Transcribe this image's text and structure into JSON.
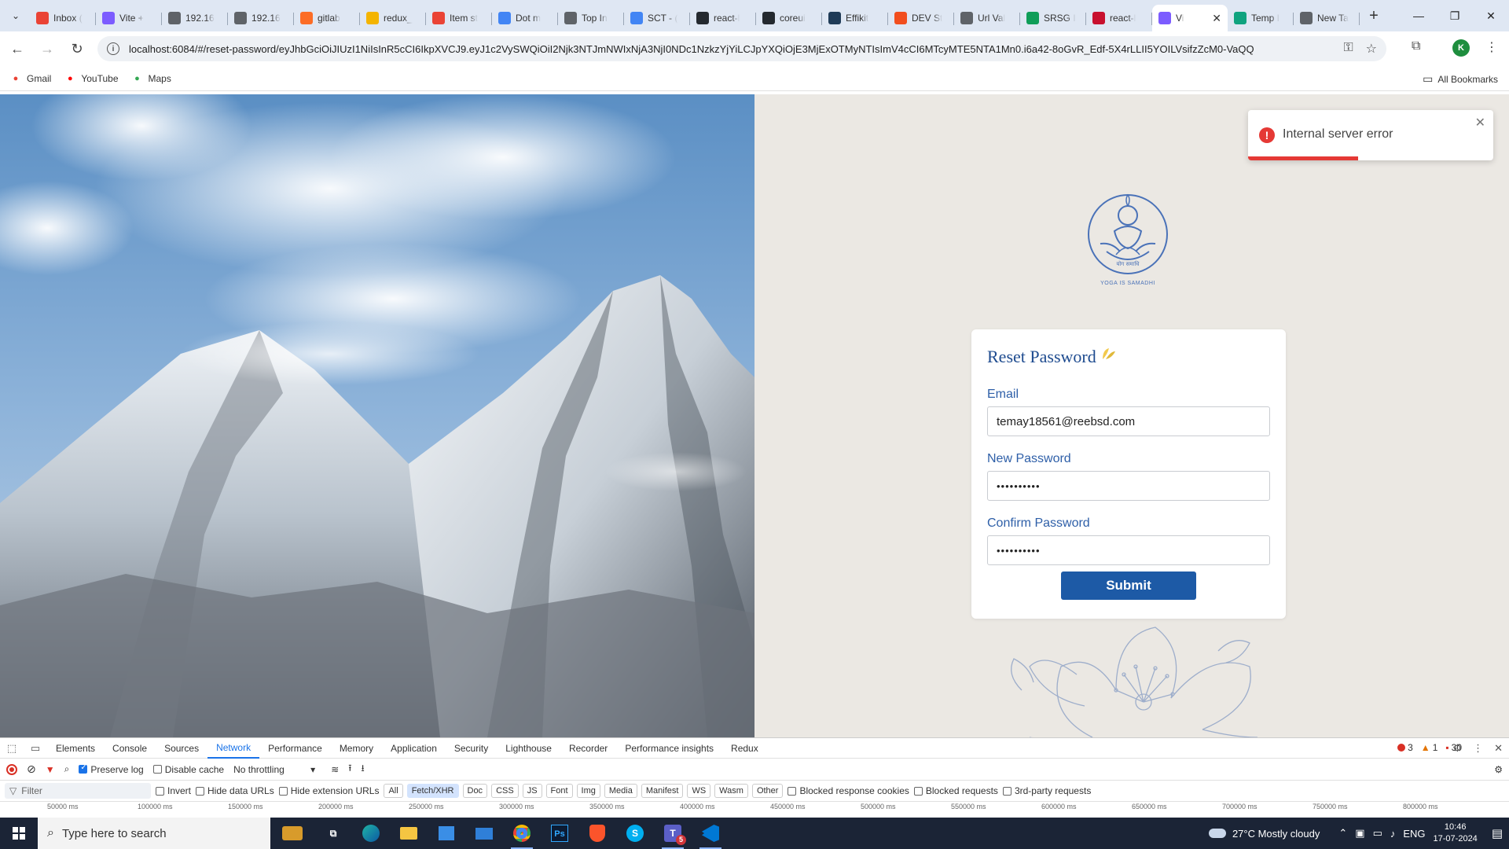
{
  "browser": {
    "tabs": [
      {
        "label": "Inbox (",
        "icon": "gmail-icon",
        "color": "#ea4335"
      },
      {
        "label": "Vite +",
        "icon": "vite-icon",
        "color": "#7c5cff"
      },
      {
        "label": "192.16",
        "icon": "globe-icon",
        "color": "#5f6368"
      },
      {
        "label": "192.16",
        "icon": "globe-icon",
        "color": "#5f6368"
      },
      {
        "label": "gitlab",
        "icon": "gitlab-icon",
        "color": "#fc6d26"
      },
      {
        "label": "redux_",
        "icon": "drive-icon",
        "color": "#f4b400"
      },
      {
        "label": "Item st",
        "icon": "gmail-icon",
        "color": "#ea4335"
      },
      {
        "label": "Dot m",
        "icon": "docs-icon",
        "color": "#4285f4"
      },
      {
        "label": "Top In",
        "icon": "leaf-icon",
        "color": "#5f6368"
      },
      {
        "label": "SCT - (",
        "icon": "docs-icon",
        "color": "#4285f4"
      },
      {
        "label": "react-l",
        "icon": "github-icon",
        "color": "#24292f"
      },
      {
        "label": "coreui",
        "icon": "github-icon",
        "color": "#24292f"
      },
      {
        "label": "Effikit",
        "icon": "effikit-icon",
        "color": "#1f3b57"
      },
      {
        "label": "DEV St",
        "icon": "figma-icon",
        "color": "#f24e1e"
      },
      {
        "label": "Url Val",
        "icon": "globe-icon",
        "color": "#5f6368"
      },
      {
        "label": "SRSG I",
        "icon": "sheets-icon",
        "color": "#0f9d58"
      },
      {
        "label": "react-l",
        "icon": "bookmark-icon",
        "color": "#c8102e"
      },
      {
        "label": "Vi",
        "icon": "vite-icon",
        "color": "#7c5cff",
        "active": true
      },
      {
        "label": "Temp I",
        "icon": "temp-icon",
        "color": "#10a37f"
      },
      {
        "label": "New Ta",
        "icon": "globe-icon",
        "color": "#5f6368"
      }
    ],
    "url": "localhost:6084/#/reset-password/eyJhbGciOiJIUzI1NiIsInR5cCI6IkpXVCJ9.eyJ1c2VySWQiOiI2Njk3NTJmNWIxNjA3NjI0NDc1NzkzYjYiLCJpYXQiOjE3MjExOTMyNTIsImV4cCI6MTcyMTE5NTA1Mn0.i6a42-8oGvR_Edf-5X4rLLII5YOILVsifzZcM0-VaQQ",
    "profile_initial": "K",
    "bookmarks": [
      {
        "label": "Gmail",
        "icon": "gmail-icon",
        "color": "#ea4335"
      },
      {
        "label": "YouTube",
        "icon": "youtube-icon",
        "color": "#ff0000"
      },
      {
        "label": "Maps",
        "icon": "maps-icon",
        "color": "#34a853"
      }
    ],
    "all_bookmarks_label": "All Bookmarks"
  },
  "page": {
    "logo_caption": "YOGA IS SAMADHI",
    "logo_script": "योग समाधि",
    "form": {
      "title": "Reset Password",
      "email_label": "Email",
      "email_value": "temay18561@reebsd.com",
      "new_password_label": "New Password",
      "new_password_value": "••••••••••",
      "confirm_password_label": "Confirm Password",
      "confirm_password_value": "••••••••••",
      "submit_label": "Submit"
    },
    "toast": {
      "message": "Internal server error",
      "progress": 0.45,
      "color": "#e53935"
    }
  },
  "devtools": {
    "tabs": [
      "Elements",
      "Console",
      "Sources",
      "Network",
      "Performance",
      "Memory",
      "Application",
      "Security",
      "Lighthouse",
      "Recorder",
      "Performance insights",
      "Redux"
    ],
    "active_tab": "Network",
    "errors": "3",
    "warnings": "1",
    "issues": "30",
    "preserve_log": "Preserve log",
    "disable_cache": "Disable cache",
    "throttling": "No throttling",
    "filter_placeholder": "Filter",
    "invert": "Invert",
    "hide_data_urls": "Hide data URLs",
    "hide_extension_urls": "Hide extension URLs",
    "type_filters": [
      "All",
      "Fetch/XHR",
      "Doc",
      "CSS",
      "JS",
      "Font",
      "Img",
      "Media",
      "Manifest",
      "WS",
      "Wasm",
      "Other"
    ],
    "active_type_filter": "Fetch/XHR",
    "blocked_cookies": "Blocked response cookies",
    "blocked_requests": "Blocked requests",
    "third_party": "3rd-party requests",
    "timeline_ticks": [
      "50000 ms",
      "100000 ms",
      "150000 ms",
      "200000 ms",
      "250000 ms",
      "300000 ms",
      "350000 ms",
      "400000 ms",
      "450000 ms",
      "500000 ms",
      "550000 ms",
      "600000 ms",
      "650000 ms",
      "700000 ms",
      "750000 ms",
      "800000 ms"
    ]
  },
  "taskbar": {
    "search_placeholder": "Type here to search",
    "weather": "27°C  Mostly cloudy",
    "language": "ENG",
    "time": "10:46",
    "date": "17-07-2024",
    "notification_badge": "5"
  }
}
